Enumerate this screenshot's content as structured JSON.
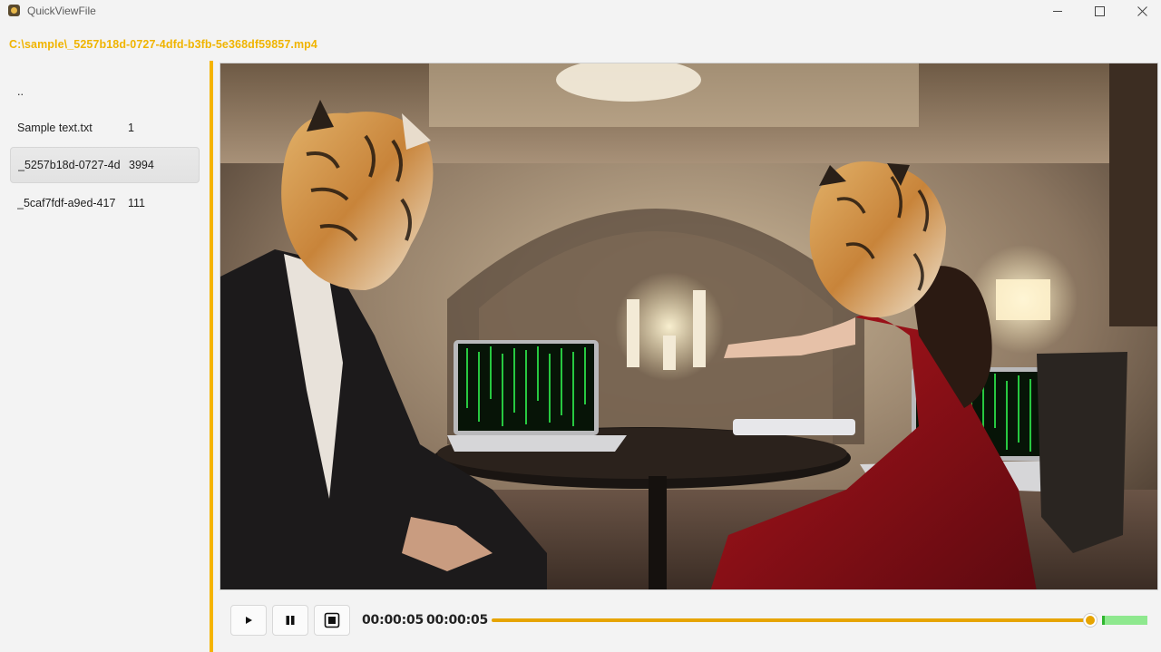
{
  "window": {
    "title": "QuickViewFile"
  },
  "path": "C:\\sample\\_5257b18d-0727-4dfd-b3fb-5e368df59857.mp4",
  "files": [
    {
      "name": "..",
      "size": ""
    },
    {
      "name": "Sample text.txt",
      "size": "1"
    },
    {
      "name": "_5257b18d-0727-4dfd-b3fb-5e368df59857.mp4",
      "size": "3994",
      "selected": true
    },
    {
      "name": "_5caf7fdf-a9ed-417",
      "size": "111"
    }
  ],
  "player": {
    "current_time": "00:00:05",
    "total_time": "00:00:05",
    "progress": 1.0,
    "volume": 1.0,
    "accent_color": "#e6a400"
  },
  "icons": {
    "play": "play-icon",
    "pause": "pause-icon",
    "stop": "stop-icon"
  }
}
